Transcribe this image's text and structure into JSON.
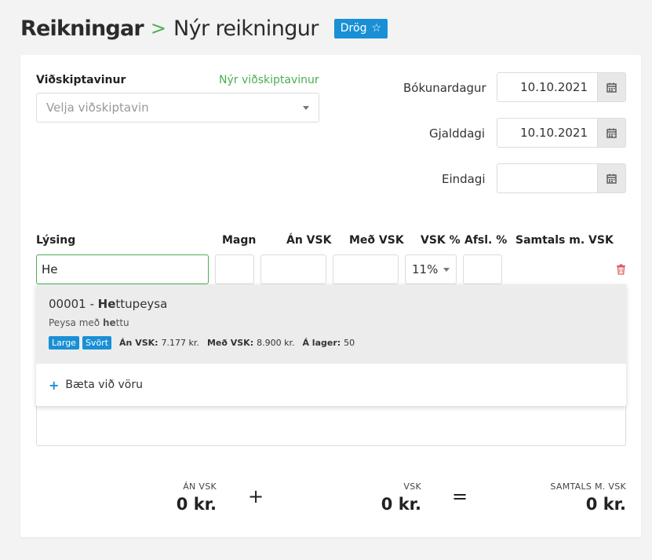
{
  "header": {
    "breadcrumb": "Reikningar",
    "separator": ">",
    "title": "Nýr reikningur",
    "status_badge": "Drög",
    "status_icon": "star-icon"
  },
  "customer": {
    "label": "Viðskiptavinur",
    "new_link": "Nýr viðskiptavinur",
    "placeholder": "Velja viðskiptavin"
  },
  "dates": {
    "booking_label": "Bókunardagur",
    "booking_value": "10.10.2021",
    "due_label": "Gjalddagi",
    "due_value": "10.10.2021",
    "final_label": "Eindagi",
    "final_value": ""
  },
  "columns": {
    "description": "Lýsing",
    "quantity": "Magn",
    "excl_vat": "Án VSK",
    "incl_vat": "Með VSK",
    "vat_pct": "VSK %",
    "discount": "Afsl. %",
    "total": "Samtals m. VSK"
  },
  "line": {
    "description_value": "He",
    "vat_value": "11%"
  },
  "suggestion": {
    "code": "00001",
    "dash": " - ",
    "name_match": "He",
    "name_rest": "ttupeysa",
    "desc_pre": "Peysa með ",
    "desc_match": "he",
    "desc_rest": "ttu",
    "tags": [
      "Large",
      "Svört"
    ],
    "excl_label": "Án VSK:",
    "excl_value": "7.177 kr.",
    "incl_label": "Með VSK:",
    "incl_value": "8.900 kr.",
    "stock_label": "Á lager:",
    "stock_value": "50"
  },
  "add_product": "Bæta við vöru",
  "totals": {
    "excl_label": "ÁN VSK",
    "excl_value": "0 kr.",
    "plus": "+",
    "vat_label": "VSK",
    "vat_value": "0 kr.",
    "equals": "=",
    "total_label": "SAMTALS M. VSK",
    "total_value": "0 kr."
  },
  "colors": {
    "accent_blue": "#1990d6",
    "accent_green": "#4caf50",
    "delete_red": "#e05a5a"
  }
}
